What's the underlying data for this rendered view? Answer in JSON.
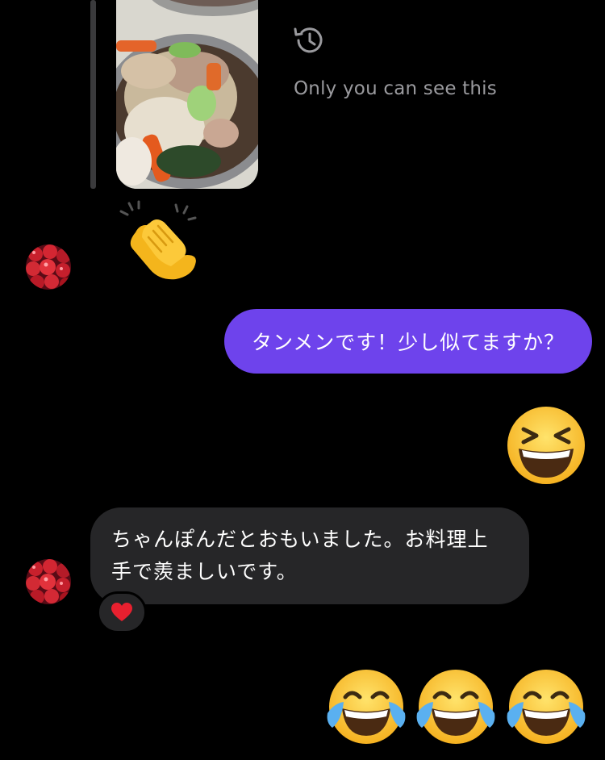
{
  "notice": {
    "text": "Only you can see this",
    "icon": "history-icon"
  },
  "messages": [
    {
      "type": "photo",
      "side": "in",
      "description_icon": "food-photo"
    },
    {
      "type": "emoji",
      "side": "in",
      "emoji": "clapping-hands"
    },
    {
      "type": "text",
      "side": "out",
      "text": "タンメンです！少し似てますか？",
      "color": "#6e43ec"
    },
    {
      "type": "emoji",
      "side": "out",
      "emoji": "grinning-squinting-face"
    },
    {
      "type": "text",
      "side": "in",
      "line1": "ちゃんぽんだとおもいました。お料理上",
      "line2": "手で羨ましいです。",
      "reaction": "heart"
    },
    {
      "type": "emoji",
      "side": "out",
      "emoji": "face-with-tears-of-joy",
      "count": 3
    }
  ]
}
